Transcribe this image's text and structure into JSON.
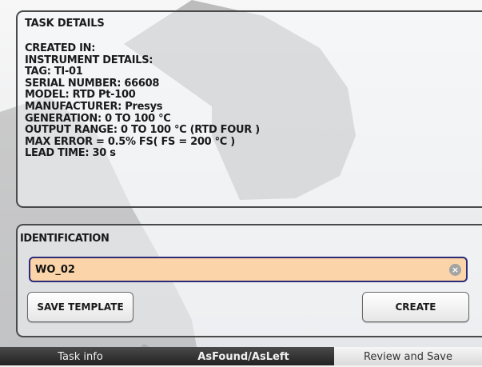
{
  "task_details": {
    "title": "TASK DETAILS",
    "lines": [
      "CREATED IN:",
      "INSTRUMENT DETAILS:",
      "TAG: TI-01",
      "SERIAL NUMBER: 66608",
      "MODEL: RTD Pt-100",
      "MANUFACTURER: Presys",
      "GENERATION: 0 TO 100 °C",
      "OUTPUT RANGE: 0 TO 100 °C (RTD FOUR )",
      "MAX ERROR = 0.5% FS( FS = 200 °C )",
      "LEAD TIME: 30 s"
    ]
  },
  "identification": {
    "title": "IDENTIFICATION",
    "input_value": "WO_02",
    "clear_icon": "clear-circle-icon",
    "save_label": "SAVE TEMPLATE",
    "create_label": "CREATE"
  },
  "tabs": [
    {
      "label": "Task info"
    },
    {
      "label": "AsFound/AsLeft"
    },
    {
      "label": "Review and Save"
    }
  ],
  "colors": {
    "input_bg": "#fbd5a9",
    "input_border": "#2b2b78",
    "tabbar": "#2e2e2e",
    "active_tab": "#e8e8e8"
  }
}
